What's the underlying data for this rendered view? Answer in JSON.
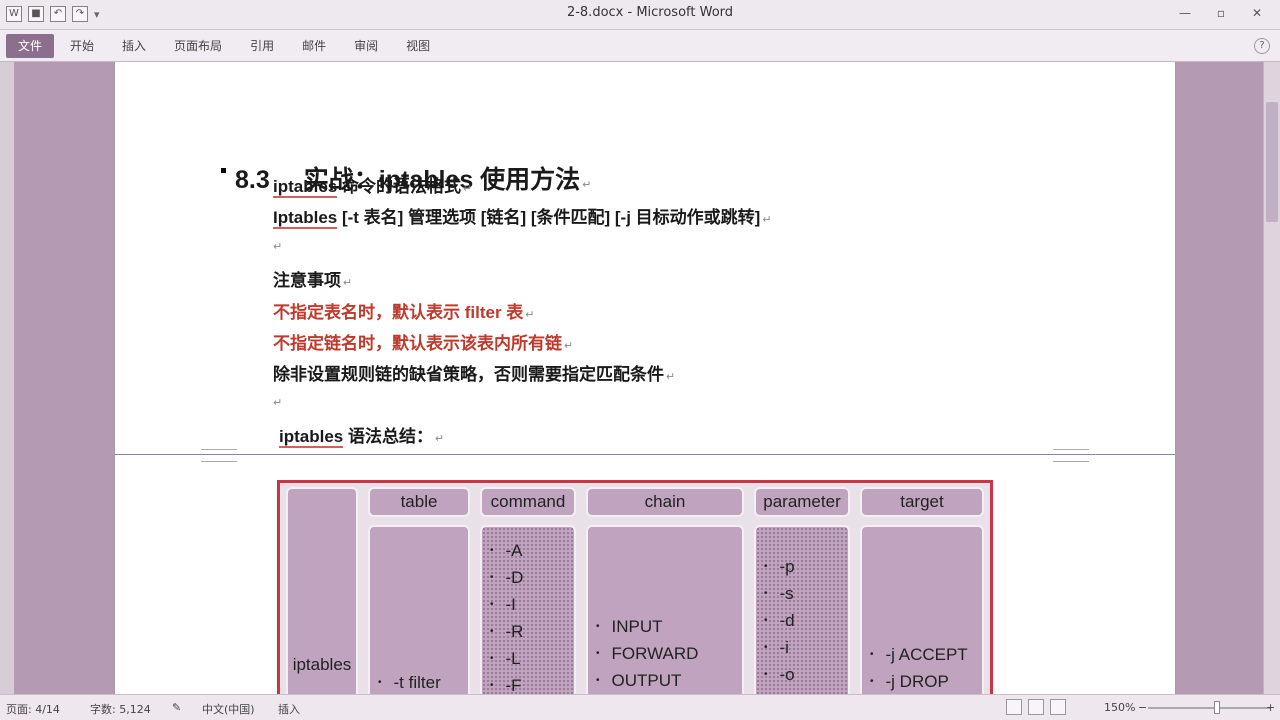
{
  "window": {
    "title": "2-8.docx - Microsoft Word",
    "controls": [
      "—",
      "▫",
      "✕"
    ]
  },
  "quick_access": [
    "save-icon",
    "undo-icon",
    "redo-icon",
    "customize-icon"
  ],
  "ribbon": {
    "tabs": [
      "文件",
      "开始",
      "插入",
      "页面布局",
      "引用",
      "邮件",
      "审阅",
      "视图"
    ],
    "help_label": "?"
  },
  "document": {
    "heading_number": "8.3",
    "heading_text": "实战：iptables 使用方法",
    "lines": [
      {
        "pre": "",
        "ul": "iptables",
        "post": " 命令的语法格式"
      },
      {
        "pre": "",
        "ul": "Iptables",
        "post": " [-t  表名]  管理选项  [链名] [条件匹配] [-j  目标动作或跳转]"
      },
      {
        "pre": "注意事项",
        "ul": "",
        "post": ""
      },
      {
        "pre": "不指定表名时，默认表示 filter 表",
        "ul": "",
        "post": ""
      },
      {
        "pre": "不指定链名时，默认表示该表内所有链",
        "ul": "",
        "post": ""
      },
      {
        "pre": "除非设置规则链的缺省策略，否则需要指定匹配条件",
        "ul": "",
        "post": ""
      },
      {
        "pre": "",
        "ul": "iptables",
        "post": " 语法总结："
      }
    ]
  },
  "diagram": {
    "headers": [
      "table",
      "command",
      "chain",
      "parameter",
      "target"
    ],
    "row_label": "iptables",
    "table_items": [
      "-t  filter"
    ],
    "command_items": [
      "-A",
      "-D",
      "-I",
      "-R",
      "-L",
      "-F"
    ],
    "chain_items": [
      "INPUT",
      "FORWARD",
      "OUTPUT"
    ],
    "parameter_items": [
      "-p",
      "-s",
      "-d",
      "-i",
      "-o"
    ],
    "target_items": [
      "-j   ACCEPT",
      "-j   DROP"
    ]
  },
  "status": {
    "page": "页面: 4/14",
    "words": "字数: 5,124",
    "language": "中文(中国)",
    "mode": "插入",
    "zoom": "150%",
    "zoom_minus": "−",
    "zoom_plus": "+"
  }
}
